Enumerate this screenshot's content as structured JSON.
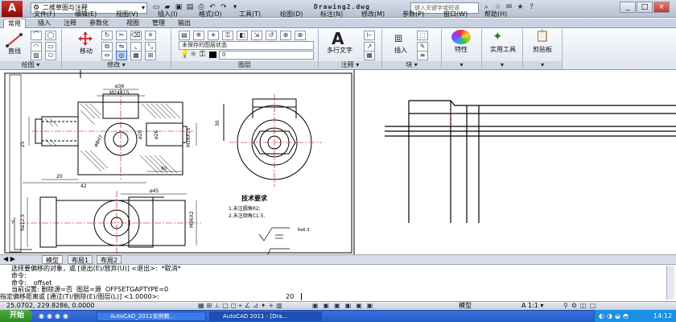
{
  "titlebar": {
    "app_logo": "A",
    "workspace": "二维草图与注释",
    "doc_title": "Drawing2.dwg",
    "search_placeholder": "键入关键字或短语",
    "win_min": "_",
    "win_max": "□",
    "win_close": "×"
  },
  "menubar": [
    "文件(F)",
    "编辑(E)",
    "视图(V)",
    "插入(I)",
    "格式(O)",
    "工具(T)",
    "绘图(D)",
    "标注(N)",
    "修改(M)",
    "参数(P)",
    "窗口(W)",
    "帮助(H)"
  ],
  "tabs": [
    "常用",
    "插入",
    "注释",
    "参数化",
    "视图",
    "管理",
    "输出"
  ],
  "ribbon": {
    "line_label": "直线",
    "move_label": "移动",
    "draw_panel": "绘图 ▾",
    "modify_panel": "修改 ▾",
    "layer_panel": "图层",
    "annotation_panel": "注释 ▾",
    "block_panel": "块 ▾",
    "layer_state": "未保存的图层状态",
    "layer_name": "0",
    "mtext_label": "多行文字",
    "insert_label": "插入",
    "properties_label": "特性",
    "utilities_label": "实用工具",
    "clipboard_label": "剪贴板"
  },
  "drawing": {
    "tech_title": "技术要求",
    "tech_1": "1.未注圆角R2;",
    "tech_2": "2.未注倒角C1.5.",
    "dims": [
      "ø36",
      "M24X15",
      "ø38",
      "ø20",
      "ø26",
      "ø30",
      "ø8H7",
      "M16X15",
      "M24X15",
      "25",
      "20",
      "60",
      "42",
      "30",
      "ø45",
      "M36X2",
      "Ra12.5",
      "Ra6.3"
    ]
  },
  "layout_tabs": [
    "模型",
    "布局1",
    "布局2"
  ],
  "command": {
    "lines": [
      "选择要偏移的对象，或 [退出(E)/放弃(U)] <退出>:  *取消*",
      "命令:",
      "命令:  _offset",
      "当前设置: 删除源=否  图层=源  OFFSETGAPTYPE=0"
    ],
    "prompt": "指定偏移距离或 [通过(T)/删除(E)/图层(L)] <1.0000>:",
    "input_value": "20"
  },
  "status": {
    "coords": "25.0702, 229.8286, 0.0000",
    "model": "模型",
    "scale": "A 1:1 ▾"
  },
  "taskbar": {
    "start": "开始",
    "items": [
      "AutoCAD_2011实例教...",
      "AutoCAD 2011 - [Dra..."
    ],
    "clock": "14:12"
  }
}
